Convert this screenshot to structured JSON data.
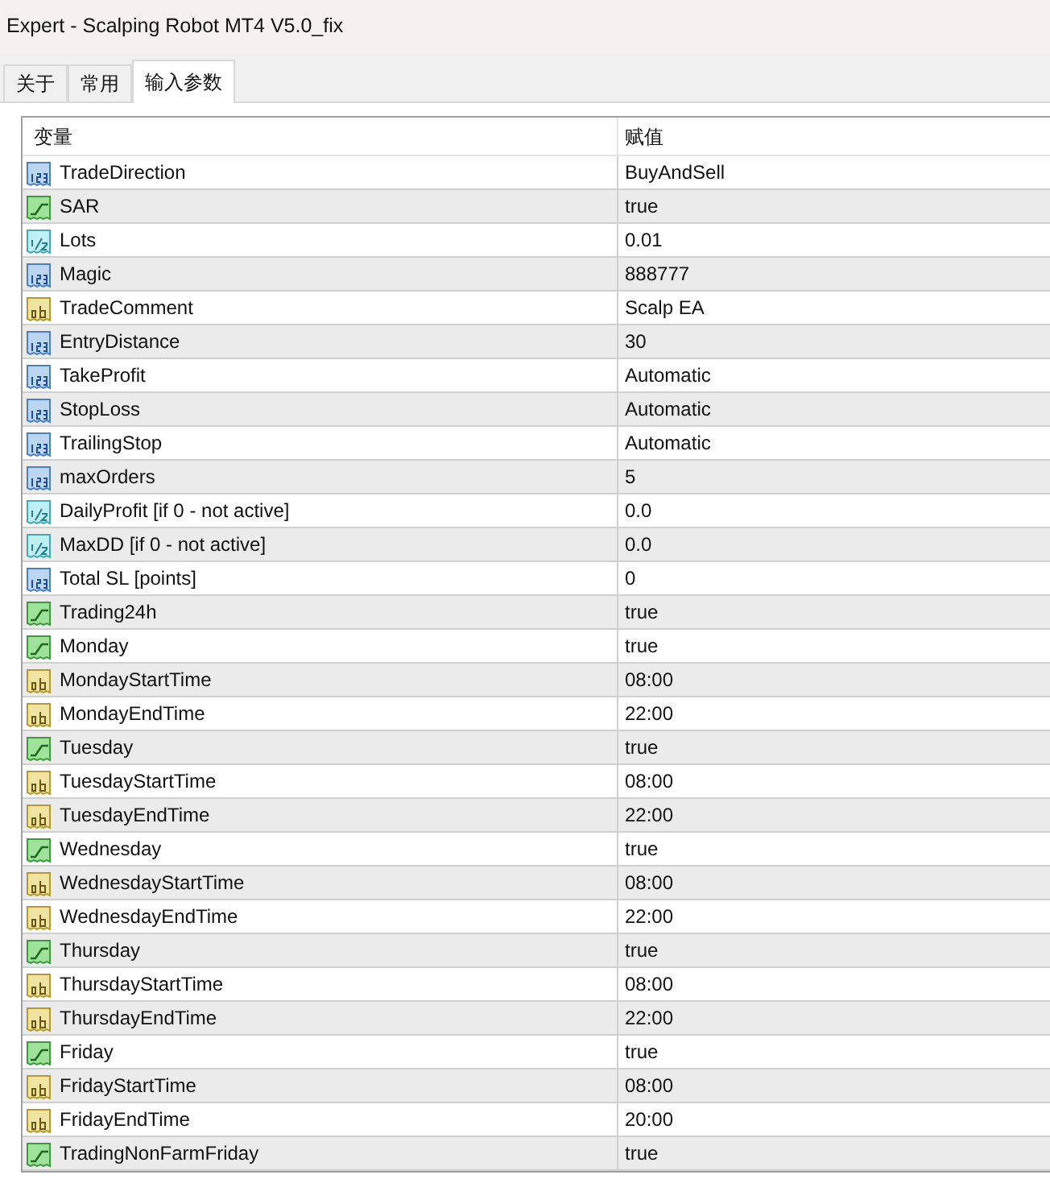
{
  "window": {
    "title": "Expert - Scalping Robot MT4 V5.0_fix"
  },
  "tabs": [
    {
      "label": "关于",
      "selected": false
    },
    {
      "label": "常用",
      "selected": false
    },
    {
      "label": "输入参数",
      "selected": true
    }
  ],
  "table": {
    "columns": [
      "变量",
      "赋值"
    ],
    "rows": [
      {
        "kind": "int",
        "name": "TradeDirection",
        "value": "BuyAndSell"
      },
      {
        "kind": "bool",
        "name": "SAR",
        "value": "true"
      },
      {
        "kind": "double",
        "name": "Lots",
        "value": "0.01"
      },
      {
        "kind": "int",
        "name": "Magic",
        "value": "888777"
      },
      {
        "kind": "string",
        "name": "TradeComment",
        "value": "Scalp EA"
      },
      {
        "kind": "int",
        "name": "EntryDistance",
        "value": "30"
      },
      {
        "kind": "int",
        "name": "TakeProfit",
        "value": "Automatic"
      },
      {
        "kind": "int",
        "name": "StopLoss",
        "value": "Automatic"
      },
      {
        "kind": "int",
        "name": "TrailingStop",
        "value": "Automatic"
      },
      {
        "kind": "int",
        "name": "maxOrders",
        "value": "5"
      },
      {
        "kind": "double",
        "name": "DailyProfit [if 0 - not active]",
        "value": "0.0"
      },
      {
        "kind": "double",
        "name": "MaxDD [if 0 - not active]",
        "value": "0.0"
      },
      {
        "kind": "int",
        "name": "Total SL [points]",
        "value": "0"
      },
      {
        "kind": "bool",
        "name": "Trading24h",
        "value": "true"
      },
      {
        "kind": "bool",
        "name": "Monday",
        "value": "true"
      },
      {
        "kind": "string",
        "name": "MondayStartTime",
        "value": "08:00"
      },
      {
        "kind": "string",
        "name": "MondayEndTime",
        "value": "22:00"
      },
      {
        "kind": "bool",
        "name": "Tuesday",
        "value": "true"
      },
      {
        "kind": "string",
        "name": "TuesdayStartTime",
        "value": "08:00"
      },
      {
        "kind": "string",
        "name": "TuesdayEndTime",
        "value": "22:00"
      },
      {
        "kind": "bool",
        "name": "Wednesday",
        "value": "true"
      },
      {
        "kind": "string",
        "name": "WednesdayStartTime",
        "value": "08:00"
      },
      {
        "kind": "string",
        "name": "WednesdayEndTime",
        "value": "22:00"
      },
      {
        "kind": "bool",
        "name": "Thursday",
        "value": "true"
      },
      {
        "kind": "string",
        "name": "ThursdayStartTime",
        "value": "08:00"
      },
      {
        "kind": "string",
        "name": "ThursdayEndTime",
        "value": "22:00"
      },
      {
        "kind": "bool",
        "name": "Friday",
        "value": "true"
      },
      {
        "kind": "string",
        "name": "FridayStartTime",
        "value": "08:00"
      },
      {
        "kind": "string",
        "name": "FridayEndTime",
        "value": "20:00"
      },
      {
        "kind": "bool",
        "name": "TradingNonFarmFriday",
        "value": "true"
      }
    ]
  }
}
